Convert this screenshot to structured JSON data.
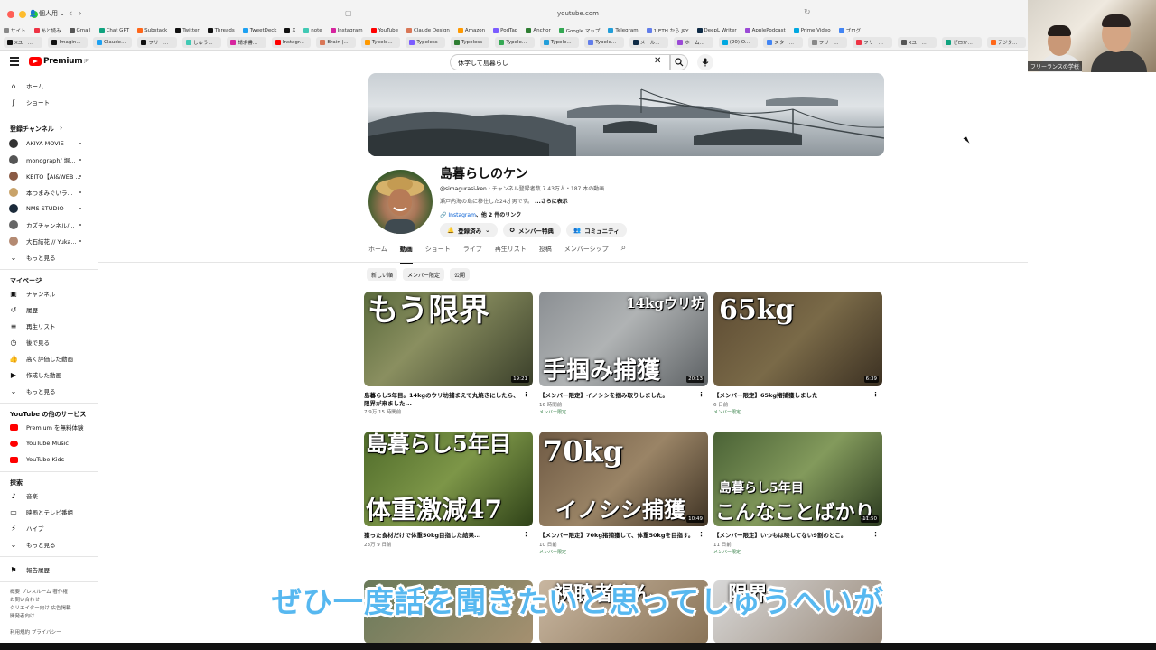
{
  "browser": {
    "profile": "個人用",
    "url": "youtube.com",
    "bookmarks_row1": [
      "サイト",
      "あと読み",
      "Gmail",
      "Chat GPT",
      "Substack",
      "Twitter",
      "Threads",
      "TweetDeck",
      "X",
      "note",
      "Instagram",
      "YouTube",
      "Claude Design",
      "Amazon",
      "PodTap",
      "Anchor",
      "Google マップ",
      "Telegram",
      "1 ETH から JPY",
      "DeepL Writer",
      "ApplePodcast",
      "Prime Video",
      "ブログ"
    ],
    "bookmarks_row2": [
      "Xユー...",
      "Imagin...",
      "Claude...",
      "フリー...",
      "しゅう...",
      "請求書...",
      "Instagr...",
      "Brain |...",
      "Typele...",
      "Typeless",
      "Typeless",
      "Typele...",
      "Typele...",
      "Typele...",
      "メール...",
      "ホーム...",
      "(20) O...",
      "スター...",
      "フリー...",
      "フリー...",
      "Xユー...",
      "ゼロか...",
      "デジタ..."
    ]
  },
  "header": {
    "logo_text": "Premium",
    "logo_sup": "JP",
    "search_value": "休学して島暮らし"
  },
  "sidebar": {
    "main": [
      {
        "label": "ホーム",
        "icon": "home-icon"
      },
      {
        "label": "ショート",
        "icon": "shorts-icon"
      }
    ],
    "subs_title": "登録チャンネル",
    "subs": [
      {
        "label": "AKIYA MOVIE",
        "color": "#333333"
      },
      {
        "label": "monograph/ 堀...",
        "color": "#555555"
      },
      {
        "label": "KEITO【AI&WEB ...",
        "color": "#8a5a44"
      },
      {
        "label": "本つまみぐいラ...",
        "color": "#c9a36a"
      },
      {
        "label": "NMS STUDIO",
        "color": "#1b2a3a"
      },
      {
        "label": "カズチャンネル/...",
        "color": "#666666"
      },
      {
        "label": "大石結花 // Yuka...",
        "color": "#b48a72"
      }
    ],
    "subs_more": "もっと見る",
    "mypage_title": "マイページ",
    "mypage": [
      {
        "label": "チャンネル",
        "icon": "channel-icon"
      },
      {
        "label": "履歴",
        "icon": "history-icon"
      },
      {
        "label": "再生リスト",
        "icon": "playlist-icon"
      },
      {
        "label": "後で見る",
        "icon": "watch-later-icon"
      },
      {
        "label": "高く評価した動画",
        "icon": "like-icon"
      },
      {
        "label": "作成した動画",
        "icon": "video-icon"
      }
    ],
    "mypage_more": "もっと見る",
    "services_title": "YouTube の他のサービス",
    "services": [
      {
        "label": "Premium を無料体験"
      },
      {
        "label": "YouTube Music"
      },
      {
        "label": "YouTube Kids"
      }
    ],
    "explore_title": "探索",
    "explore": [
      {
        "label": "音楽",
        "icon": "music-icon"
      },
      {
        "label": "映画とテレビ番組",
        "icon": "film-icon"
      },
      {
        "label": "ハイプ",
        "icon": "hype-icon"
      }
    ],
    "explore_more": "もっと見る",
    "report": "報告履歴",
    "footer": [
      "概要 プレスルーム 著作権",
      "お問い合わせ",
      "クリエイター向け 広告掲載",
      "開発者向け",
      "",
      "利用規約 プライバシー"
    ]
  },
  "channel": {
    "name": "島暮らしのケン",
    "handle": "@simagurasi-ken",
    "meta": "・チャンネル登録者数 7.43万人・187 本の動画",
    "desc": "瀬戸内海の島に移住した24才男です。",
    "desc_more": "...さらに表示",
    "link": "Instagram",
    "link_more": "、他 2 件のリンク",
    "btn_subscribed": "登録済み",
    "btn_member": "メンバー特典",
    "btn_community": "コミュニティ"
  },
  "tabs": [
    "ホーム",
    "動画",
    "ショート",
    "ライブ",
    "再生リスト",
    "投稿",
    "メンバーシップ"
  ],
  "chips": [
    "新しい順",
    "メンバー限定",
    "公開"
  ],
  "videos": [
    {
      "thumb_text": "もう限界",
      "duration": "19:21",
      "title": "島暮らし5年目。14kgのウリ坊捕まえて丸焼きにしたら、限界が来ました...",
      "meta": "7.9万  15 時間前",
      "badge": ""
    },
    {
      "thumb_text": "手掴み捕獲",
      "thumb_text2": "14kgウリ坊",
      "duration": "20:13",
      "title": "【メンバー限定】イノシシを掴み取りしました。",
      "meta": "16 時間前",
      "badge": "メンバー限定"
    },
    {
      "thumb_text": "65kg",
      "duration": "6:39",
      "title": "【メンバー限定】65kg猪捕獲しました",
      "meta": "6 日前",
      "badge": "メンバー限定"
    },
    {
      "thumb_text": "島暮らし5年目",
      "thumb_text2": "体重激減47",
      "duration": "",
      "title": "獲った食材だけで体重50kg目指した結果...",
      "meta": "23万  9 日前",
      "badge": ""
    },
    {
      "thumb_text": "70kg",
      "thumb_text2": "イノシシ捕獲",
      "duration": "10:49",
      "title": "【メンバー限定】70kg猪捕獲して、体重50kgを目指す。",
      "meta": "10 日前",
      "badge": "メンバー限定"
    },
    {
      "thumb_text": "島暮らし5年目",
      "thumb_text2": "こんなことばかり",
      "duration": "11:50",
      "title": "【メンバー限定】いつもは映してない9割のとこ。",
      "meta": "11 日前",
      "badge": "メンバー限定"
    }
  ],
  "row3_partial": [
    "",
    "視聴者さん",
    "限界"
  ],
  "webcam_label": "フリーランスの学校",
  "caption": "ぜひ一度話を聞きたいと思ってしゅうへいが"
}
